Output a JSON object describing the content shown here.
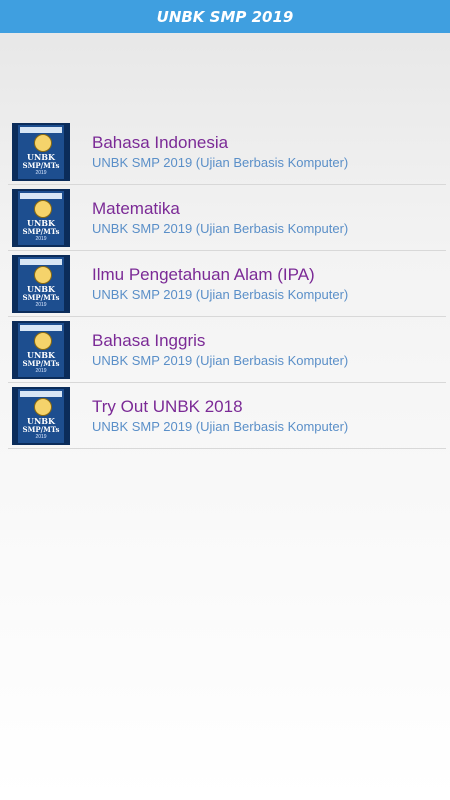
{
  "appbar": {
    "title": "UNBK SMP 2019"
  },
  "items": [
    {
      "title": "Bahasa Indonesia",
      "subtitle": "UNBK SMP 2019 (Ujian Berbasis Komputer)"
    },
    {
      "title": "Matematika",
      "subtitle": "UNBK SMP 2019 (Ujian Berbasis Komputer)"
    },
    {
      "title": "Ilmu Pengetahuan Alam (IPA)",
      "subtitle": "UNBK SMP 2019 (Ujian Berbasis Komputer)"
    },
    {
      "title": "Bahasa Inggris",
      "subtitle": "UNBK SMP 2019 (Ujian Berbasis Komputer)"
    },
    {
      "title": "Try Out UNBK 2018",
      "subtitle": "UNBK SMP 2019 (Ujian Berbasis Komputer)"
    }
  ],
  "thumb": {
    "line1": "UNBK",
    "line2": "SMP/MTs",
    "line3": "2019"
  }
}
